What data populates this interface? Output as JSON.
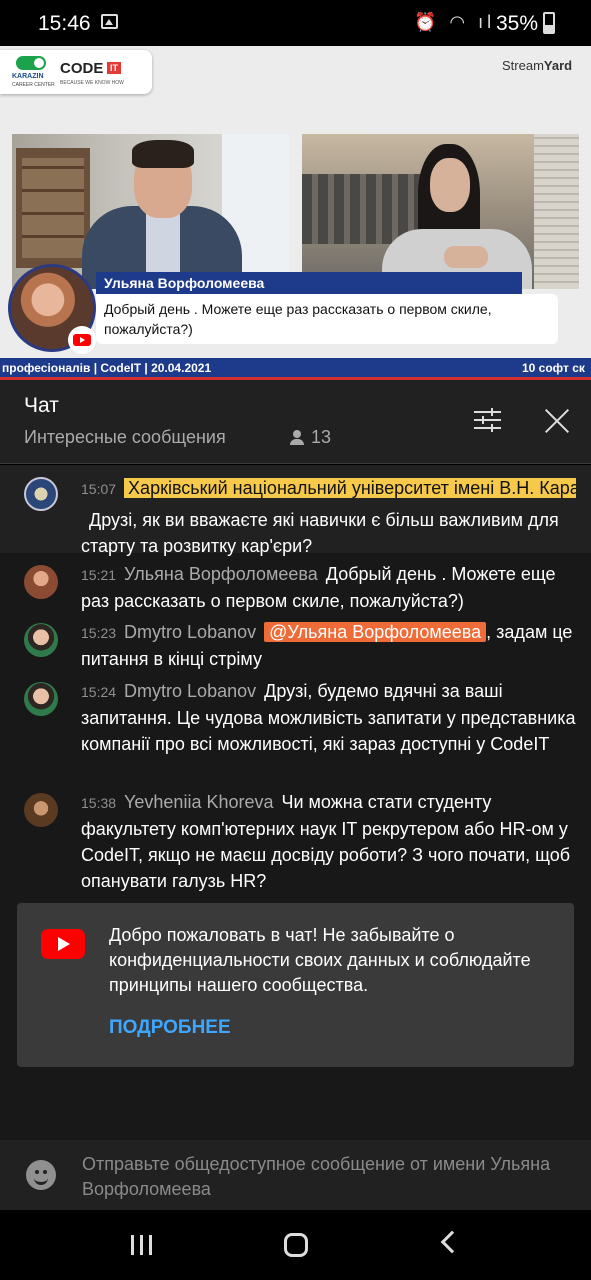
{
  "status_bar": {
    "time": "15:46",
    "battery": "35%"
  },
  "stream": {
    "streamyard_prefix": "Stream",
    "streamyard_bold": "Yard",
    "logo_karazin": "KARAZIN",
    "logo_career": "CAREER CENTER",
    "logo_code": "CODE",
    "logo_it": "IT",
    "logo_tagline": "BECAUSE WE KNOW HOW",
    "banner_name": "Ульяна Ворфоломеева",
    "banner_message": "Добрый день . Можете еще раз рассказать о первом скиле, пожалуйста?)",
    "ticker_left": "професіоналів | CodeIT | 20.04.2021",
    "ticker_right": "10 софт ск"
  },
  "chat_header": {
    "title": "Чат",
    "subtitle": "Интересные сообщения",
    "viewer_count": "13"
  },
  "messages": [
    {
      "time": "15:07",
      "author": "Харківський національний університет імені В.Н. Каразіна",
      "text": "Друзі, як ви вважаєте які навички є більш важливим для старту та розвитку кар'єри?"
    },
    {
      "time": "15:21",
      "author": "Ульяна Ворфоломеева",
      "text": "Добрый день . Можете еще раз рассказать о первом скиле, пожалуйста?)"
    },
    {
      "time": "15:23",
      "author": "Dmytro Lobanov",
      "mention": "@Ульяна Ворфоломеева",
      "text": "задам це питання в кінці стріму"
    },
    {
      "time": "15:24",
      "author": "Dmytro Lobanov",
      "text": "Друзі, будемо вдячні за ваші запитання. Це чудова можливість запитати у представника компанії про всі можливості, які зараз доступні у CodeIT"
    },
    {
      "time": "15:38",
      "author": "Yevheniia Khoreva",
      "text": "Чи можна стати студенту факультету комп'ютерних наук IT рекрутером або HR-ом у CodeIT, якщо не маєш досвіду роботи? З чого почати, щоб опанувати галузь HR?"
    }
  ],
  "welcome": {
    "text": "Добро пожаловать в чат! Не забывайте о конфиденциальности своих данных и соблюдайте принципы нашего сообщества.",
    "more_link": "ПОДРОБНЕЕ"
  },
  "input": {
    "placeholder": "Отправьте общедоступное сообщение от имени Ульяна Ворфоломеева"
  },
  "colors": {
    "accent_link": "#3ea6ff",
    "mention_bg": "#ef6c38",
    "owner_highlight": "#f7c94a",
    "youtube_red": "#ff0000"
  }
}
